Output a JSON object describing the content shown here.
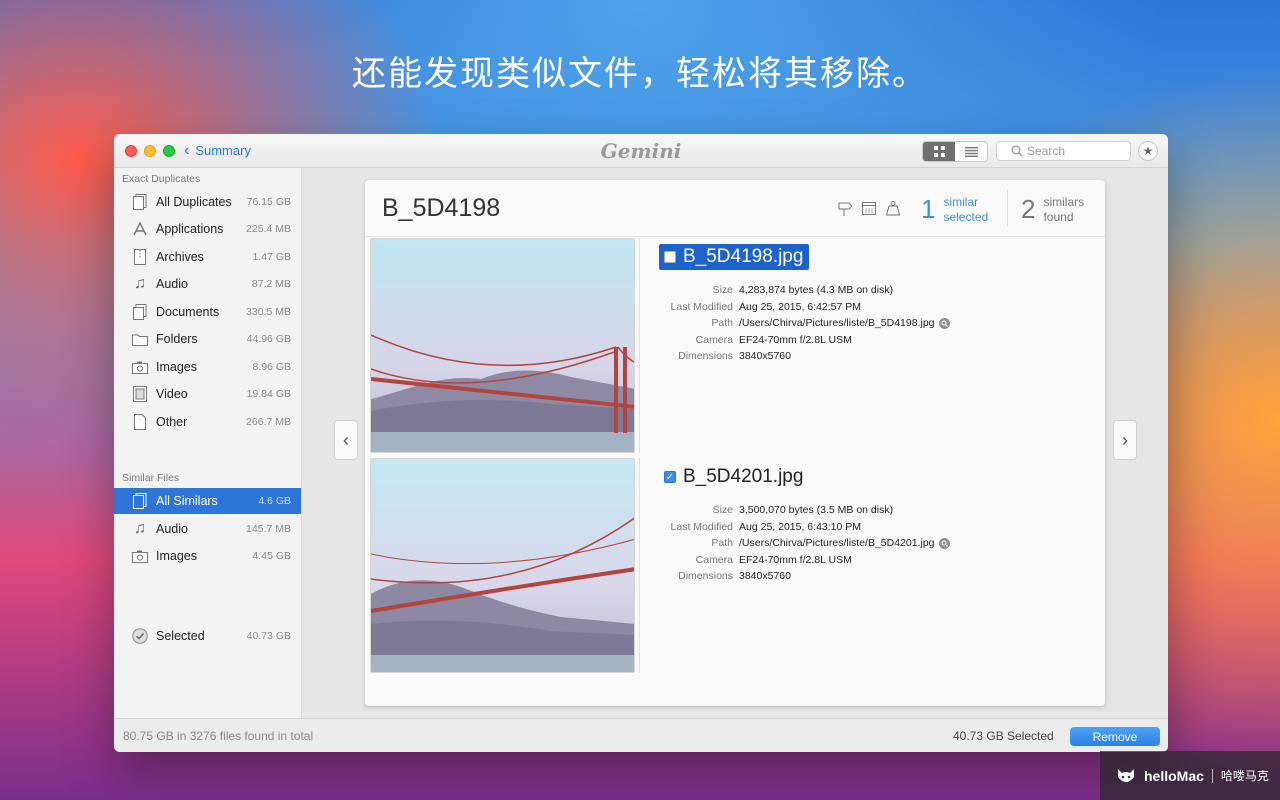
{
  "headline": "还能发现类似文件，轻松将其移除。",
  "titlebar": {
    "back_label": "Summary",
    "app_name": "Gemini",
    "search_placeholder": "Search"
  },
  "sidebar": {
    "exact_title": "Exact Duplicates",
    "exact_items": [
      {
        "label": "All Duplicates",
        "size": "76.15 GB",
        "icon": "all-duplicates-icon"
      },
      {
        "label": "Applications",
        "size": "225.4 MB",
        "icon": "applications-icon"
      },
      {
        "label": "Archives",
        "size": "1.47 GB",
        "icon": "archives-icon"
      },
      {
        "label": "Audio",
        "size": "87.2 MB",
        "icon": "audio-icon"
      },
      {
        "label": "Documents",
        "size": "330.5 MB",
        "icon": "documents-icon"
      },
      {
        "label": "Folders",
        "size": "44.96 GB",
        "icon": "folders-icon"
      },
      {
        "label": "Images",
        "size": "8.96 GB",
        "icon": "images-icon"
      },
      {
        "label": "Video",
        "size": "19.84 GB",
        "icon": "video-icon"
      },
      {
        "label": "Other",
        "size": "266.7 MB",
        "icon": "other-icon"
      }
    ],
    "similar_title": "Similar Files",
    "similar_items": [
      {
        "label": "All Similars",
        "size": "4.6 GB",
        "icon": "all-similars-icon",
        "active": true
      },
      {
        "label": "Audio",
        "size": "145.7 MB",
        "icon": "audio-icon"
      },
      {
        "label": "Images",
        "size": "4.45 GB",
        "icon": "images-icon"
      }
    ],
    "selected": {
      "label": "Selected",
      "size": "40.73 GB",
      "icon": "selected-icon"
    }
  },
  "group": {
    "title": "B_5D4198",
    "selected_count": "1",
    "selected_label_1": "similar",
    "selected_label_2": "selected",
    "found_count": "2",
    "found_label_1": "similars",
    "found_label_2": "found"
  },
  "meta_keys": {
    "size": "Size",
    "modified": "Last Modified",
    "path": "Path",
    "camera": "Camera",
    "dimensions": "Dimensions"
  },
  "files": [
    {
      "name": "B_5D4198.jpg",
      "checked": false,
      "size": "4,283,874 bytes (4.3 MB on disk)",
      "modified": "Aug 25, 2015, 6:42:57 PM",
      "path": "/Users/Chirva/Pictures/liste/B_5D4198.jpg",
      "camera": "EF24-70mm f/2.8L USM",
      "dimensions": "3840x5760"
    },
    {
      "name": "B_5D4201.jpg",
      "checked": true,
      "size": "3,500,070 bytes (3.5 MB on disk)",
      "modified": "Aug 25, 2015, 6:43:10 PM",
      "path": "/Users/Chirva/Pictures/liste/B_5D4201.jpg",
      "camera": "EF24-70mm f/2.8L USM",
      "dimensions": "3840x5760"
    }
  ],
  "bottombar": {
    "total": "80.75 GB in 3276 files found in total",
    "selected_total": "40.73 GB Selected",
    "remove_label": "Remove"
  },
  "watermark": {
    "brand": "helloMac",
    "cn": "哈喽马克"
  },
  "colors": {
    "accent": "#2f75d6",
    "remove_button": "#2d82e6"
  }
}
